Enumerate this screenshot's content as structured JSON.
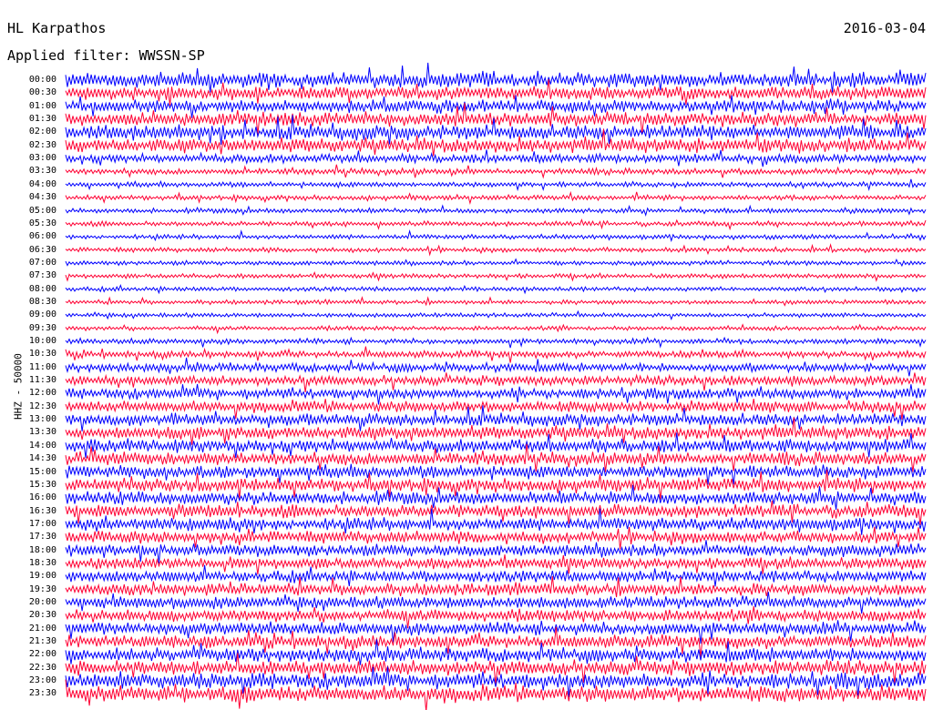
{
  "header": {
    "station": "HL Karpathos",
    "date": "2016-03-04",
    "filter": "Applied filter: WWSSN-SP"
  },
  "chart_data": {
    "type": "line",
    "title": "HL Karpathos",
    "ylabel": "HHZ - 50000",
    "time_labels": [
      "00:00",
      "00:30",
      "01:00",
      "01:30",
      "02:00",
      "02:30",
      "03:00",
      "03:30",
      "04:00",
      "04:30",
      "05:00",
      "05:30",
      "06:00",
      "06:30",
      "07:00",
      "07:30",
      "08:00",
      "08:30",
      "09:00",
      "09:30",
      "10:00",
      "10:30",
      "11:00",
      "11:30",
      "12:00",
      "12:30",
      "13:00",
      "13:30",
      "14:00",
      "14:30",
      "15:00",
      "15:30",
      "16:00",
      "16:30",
      "17:00",
      "17:30",
      "18:00",
      "18:30",
      "19:00",
      "19:30",
      "20:00",
      "20:30",
      "21:00",
      "21:30",
      "22:00",
      "22:30",
      "23:00",
      "23:30"
    ],
    "series_colors": [
      "#0000ff",
      "#ff0033"
    ],
    "trace_noise_level": [
      0.85,
      0.75,
      0.7,
      0.8,
      0.85,
      0.8,
      0.5,
      0.35,
      0.3,
      0.28,
      0.28,
      0.28,
      0.27,
      0.27,
      0.26,
      0.26,
      0.25,
      0.25,
      0.25,
      0.25,
      0.3,
      0.4,
      0.5,
      0.55,
      0.6,
      0.65,
      0.7,
      0.75,
      0.75,
      0.75,
      0.75,
      0.75,
      0.75,
      0.75,
      0.75,
      0.7,
      0.7,
      0.65,
      0.65,
      0.7,
      0.7,
      0.7,
      0.7,
      0.75,
      0.8,
      0.85,
      0.9,
      0.95
    ]
  }
}
